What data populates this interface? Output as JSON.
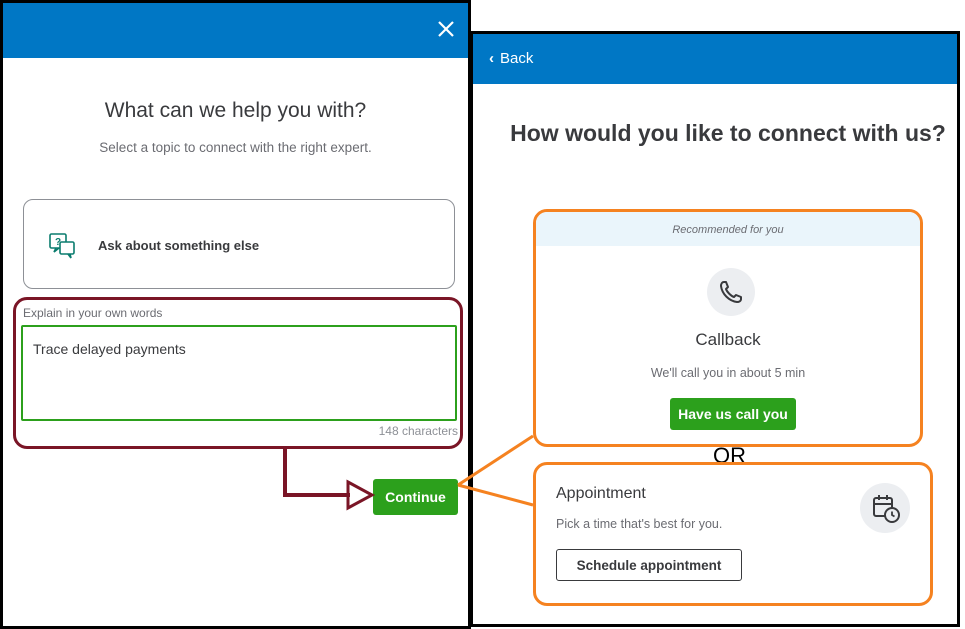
{
  "left": {
    "title": "What can we help you with?",
    "subtitle": "Select a topic to connect with the right expert.",
    "topic_label": "Ask about something else",
    "explain_label": "Explain in your own words",
    "explain_value": "Trace delayed payments",
    "char_count": "148 characters",
    "continue_label": "Continue",
    "close_icon": "close-icon",
    "topic_icon": "chat-question-icon"
  },
  "right": {
    "back_label": "Back",
    "title": "How would you like to connect with us?",
    "recommended": "Recommended for you",
    "callback_title": "Callback",
    "callback_desc": "We'll call you in about 5 min",
    "callback_button": "Have us call you",
    "or_text": "OR",
    "appointment_title": "Appointment",
    "appointment_desc": "Pick a time that's best for you.",
    "schedule_button": "Schedule appointment",
    "phone_icon": "phone-icon",
    "calendar_icon": "calendar-clock-icon"
  },
  "colors": {
    "header_blue": "#0077c5",
    "action_green": "#2ca01c",
    "annotation_maroon": "#7a1526",
    "annotation_orange": "#f58220"
  }
}
